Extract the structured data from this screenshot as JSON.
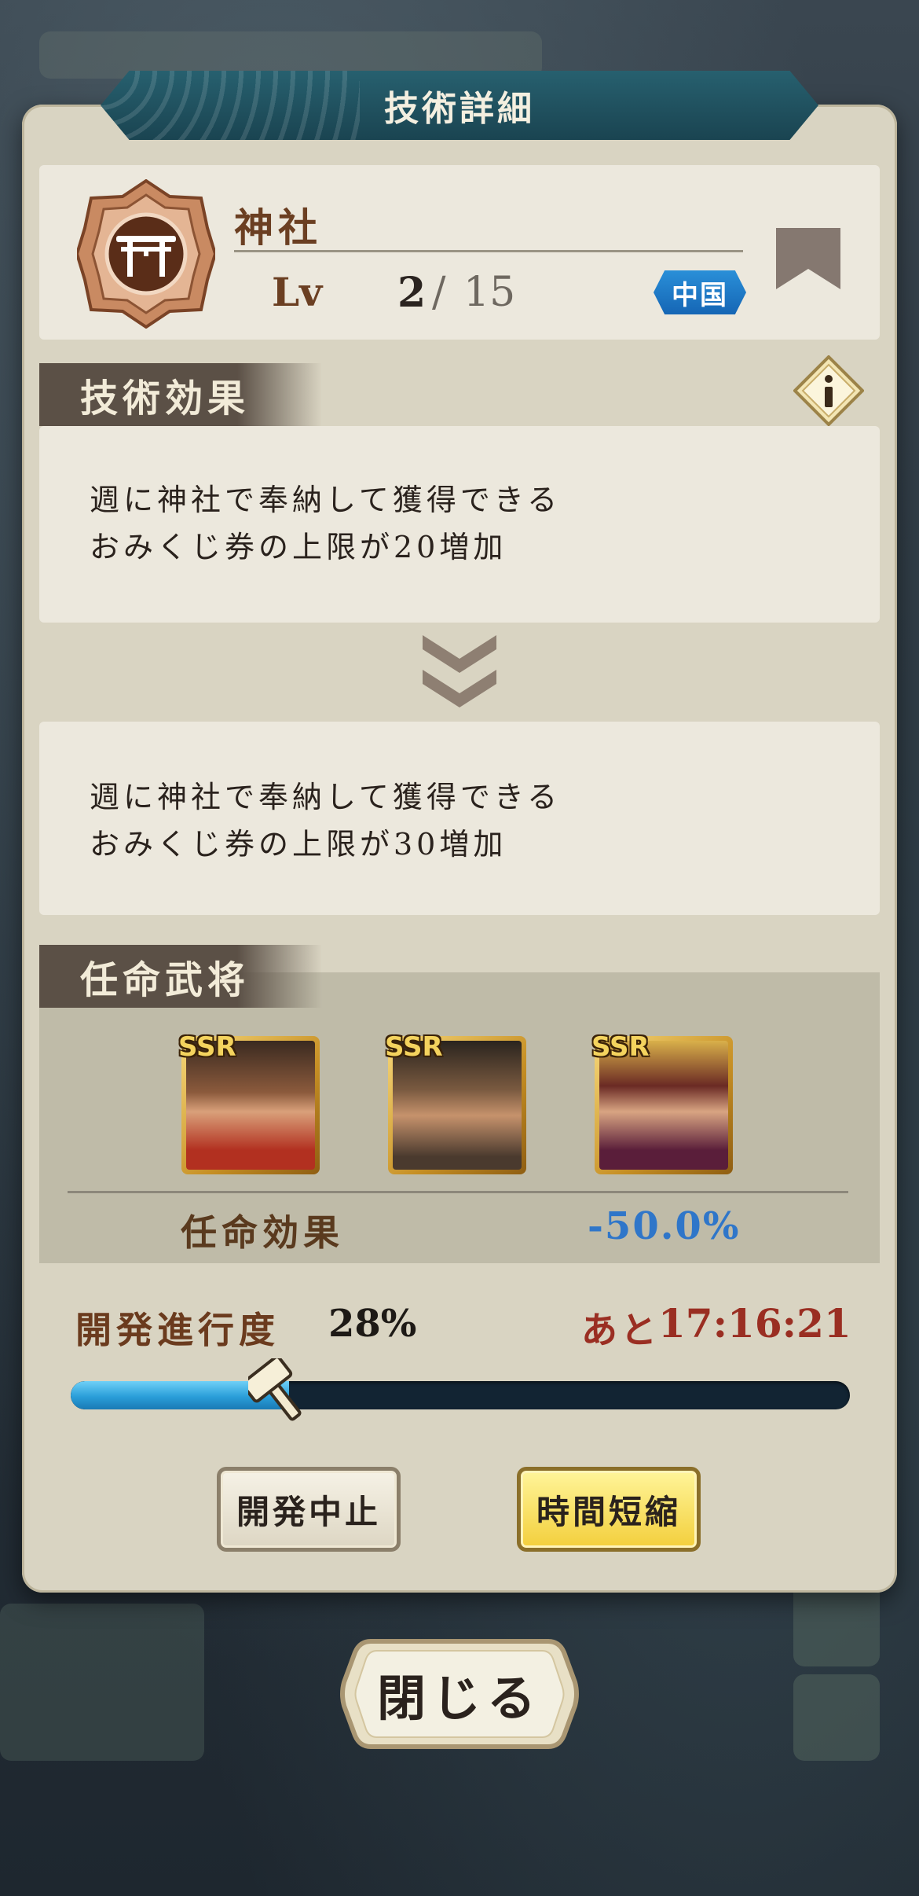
{
  "dialog": {
    "title": "技術詳細",
    "tech": {
      "name": "神社",
      "icon": "torii-icon",
      "level_label": "Lv",
      "level_current": "2",
      "level_separator": "/",
      "level_max": "15",
      "region": "中国"
    },
    "effect_section": {
      "label": "技術効果",
      "current_line1": "週に神社で奉納して獲得できる",
      "current_line2": "おみくじ券の上限が20増加",
      "next_line1": "週に神社で奉納して獲得できる",
      "next_line2": "おみくじ券の上限が30増加"
    },
    "officer_section": {
      "label": "任命武将",
      "officers": [
        {
          "rarity": "SSR",
          "icon": "officer-portrait-1"
        },
        {
          "rarity": "SSR",
          "icon": "officer-portrait-2"
        },
        {
          "rarity": "SSR",
          "icon": "officer-portrait-3"
        }
      ],
      "appoint_effect_label": "任命効果",
      "appoint_effect_value": "-50.0%"
    },
    "progress": {
      "label": "開発進行度",
      "value": "28%",
      "fraction": 0.28,
      "remaining_prefix": "あと",
      "remaining_time": "17:16:21"
    },
    "buttons": {
      "stop": "開発中止",
      "shorten": "時間短縮"
    }
  },
  "close_button": "閉じる",
  "colors": {
    "title_bar": "#1f4f5c",
    "panel": "#d9d4c2",
    "progress_fill": "#2a9ed9",
    "appoint_value": "#2f76c9",
    "remaining": "#9a2e22",
    "region_badge": "#1a73c4"
  }
}
